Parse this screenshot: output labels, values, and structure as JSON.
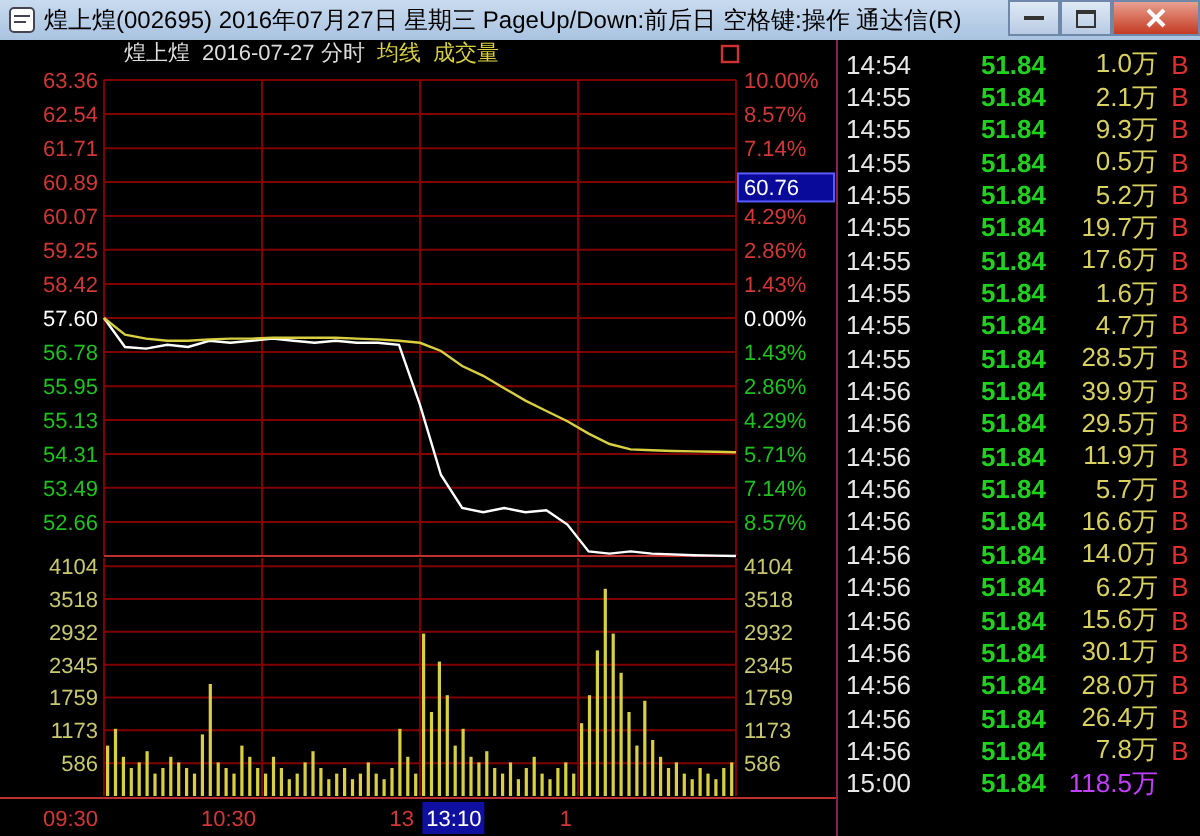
{
  "window": {
    "title": "煌上煌(002695) 2016年07月27日 星期三 PageUp/Down:前后日 空格键:操作 通达信(R)"
  },
  "header": {
    "stock": "煌上煌",
    "period": "2016-07-27 分时"
  },
  "price_chart": {
    "chart_data": {
      "type": "line",
      "grid": true,
      "series": [
        {
          "color": "#ffffff",
          "values": [
            57.6,
            56.9,
            56.86,
            56.95,
            56.9,
            57.05,
            57.0,
            57.05,
            57.1,
            57.05,
            57.0,
            57.05,
            57.0,
            57.0,
            56.95,
            55.5,
            53.8,
            53.0,
            52.9,
            53.0,
            52.9,
            52.95,
            52.6,
            51.95,
            51.9,
            51.95,
            51.9,
            51.88,
            51.86,
            51.85,
            51.84
          ]
        },
        {
          "name": "均线",
          "color": "#d8d040",
          "values": [
            57.6,
            57.2,
            57.1,
            57.05,
            57.05,
            57.08,
            57.1,
            57.1,
            57.12,
            57.12,
            57.12,
            57.12,
            57.1,
            57.08,
            57.05,
            57.0,
            56.8,
            56.44,
            56.2,
            55.9,
            55.6,
            55.35,
            55.1,
            54.8,
            54.55,
            54.42,
            54.4,
            54.38,
            54.37,
            54.36,
            54.35
          ]
        }
      ],
      "ylim": [
        51.84,
        63.36
      ],
      "yticks": [
        {
          "value": 63.36,
          "label": "63.36"
        },
        {
          "value": 62.54,
          "label": "62.54"
        },
        {
          "value": 61.71,
          "label": "61.71"
        },
        {
          "value": 60.89,
          "label": "60.89"
        },
        {
          "value": 60.07,
          "label": "60.07"
        },
        {
          "value": 59.25,
          "label": "59.25"
        },
        {
          "value": 58.42,
          "label": "58.42"
        },
        {
          "value": 57.6,
          "label": "57.60"
        },
        {
          "value": 56.78,
          "label": "56.78"
        },
        {
          "value": 55.95,
          "label": "55.95"
        },
        {
          "value": 55.13,
          "label": "55.13"
        },
        {
          "value": 54.31,
          "label": "54.31"
        },
        {
          "value": 53.49,
          "label": "53.49"
        },
        {
          "value": 52.66,
          "label": "52.66"
        }
      ]
    },
    "percent_labels": [
      {
        "text": "10.00%",
        "kind": "up"
      },
      {
        "text": "8.57%",
        "kind": "up"
      },
      {
        "text": "7.14%",
        "kind": "up"
      },
      {
        "text": "4.29%",
        "kind": "up"
      },
      {
        "text": "2.86%",
        "kind": "up"
      },
      {
        "text": "1.43%",
        "kind": "up"
      },
      {
        "text": "0.00%",
        "kind": "zero"
      },
      {
        "text": "1.43%",
        "kind": "down"
      },
      {
        "text": "2.86%",
        "kind": "down"
      },
      {
        "text": "4.29%",
        "kind": "down"
      },
      {
        "text": "5.71%",
        "kind": "down"
      },
      {
        "text": "7.14%",
        "kind": "down"
      },
      {
        "text": "8.57%",
        "kind": "down"
      }
    ],
    "cursor_price": "60.76"
  },
  "volume_chart": {
    "chart_data": {
      "type": "bar",
      "grid": true,
      "series": [
        {
          "name": "成交量",
          "color": "#d8d040",
          "values": [
            900,
            1200,
            700,
            500,
            600,
            800,
            400,
            500,
            700,
            600,
            500,
            400,
            1100,
            2000,
            600,
            500,
            400,
            900,
            700,
            500,
            400,
            700,
            500,
            300,
            400,
            600,
            800,
            500,
            300,
            400,
            500,
            300,
            400,
            600,
            400,
            300,
            500,
            1200,
            700,
            400,
            2900,
            1500,
            2400,
            1800,
            900,
            1200,
            700,
            600,
            800,
            500,
            400,
            600,
            300,
            500,
            700,
            400,
            300,
            500,
            600,
            400,
            1300,
            1800,
            2600,
            3700,
            2900,
            2200,
            1500,
            900,
            1700,
            1000,
            700,
            500,
            600,
            400,
            300,
            500,
            400,
            300,
            500,
            600
          ]
        }
      ],
      "ylim": [
        0,
        4250
      ],
      "yticks": [
        {
          "value": 4104,
          "label": "4104"
        },
        {
          "value": 3518,
          "label": "3518"
        },
        {
          "value": 2932,
          "label": "2932"
        },
        {
          "value": 2345,
          "label": "2345"
        },
        {
          "value": 1759,
          "label": "1759"
        },
        {
          "value": 1173,
          "label": "1173"
        },
        {
          "value": 586,
          "label": "586"
        }
      ]
    },
    "time_axis": [
      "09:30",
      "10:30",
      "13",
      "1"
    ],
    "right_labels": [
      "4104",
      "3518",
      "2932",
      "2345",
      "1759",
      "1173",
      "586"
    ],
    "cursor_time": "13:10"
  },
  "ticks": [
    {
      "time": "14:54",
      "price": "51.84",
      "volume": "1.0万",
      "side": "B",
      "large": false
    },
    {
      "time": "14:55",
      "price": "51.84",
      "volume": "2.1万",
      "side": "B",
      "large": false
    },
    {
      "time": "14:55",
      "price": "51.84",
      "volume": "9.3万",
      "side": "B",
      "large": false
    },
    {
      "time": "14:55",
      "price": "51.84",
      "volume": "0.5万",
      "side": "B",
      "large": false
    },
    {
      "time": "14:55",
      "price": "51.84",
      "volume": "5.2万",
      "side": "B",
      "large": false
    },
    {
      "time": "14:55",
      "price": "51.84",
      "volume": "19.7万",
      "side": "B",
      "large": false
    },
    {
      "time": "14:55",
      "price": "51.84",
      "volume": "17.6万",
      "side": "B",
      "large": false
    },
    {
      "time": "14:55",
      "price": "51.84",
      "volume": "1.6万",
      "side": "B",
      "large": false
    },
    {
      "time": "14:55",
      "price": "51.84",
      "volume": "4.7万",
      "side": "B",
      "large": false
    },
    {
      "time": "14:55",
      "price": "51.84",
      "volume": "28.5万",
      "side": "B",
      "large": false
    },
    {
      "time": "14:56",
      "price": "51.84",
      "volume": "39.9万",
      "side": "B",
      "large": false
    },
    {
      "time": "14:56",
      "price": "51.84",
      "volume": "29.5万",
      "side": "B",
      "large": false
    },
    {
      "time": "14:56",
      "price": "51.84",
      "volume": "11.9万",
      "side": "B",
      "large": false
    },
    {
      "time": "14:56",
      "price": "51.84",
      "volume": "5.7万",
      "side": "B",
      "large": false
    },
    {
      "time": "14:56",
      "price": "51.84",
      "volume": "16.6万",
      "side": "B",
      "large": false
    },
    {
      "time": "14:56",
      "price": "51.84",
      "volume": "14.0万",
      "side": "B",
      "large": false
    },
    {
      "time": "14:56",
      "price": "51.84",
      "volume": "6.2万",
      "side": "B",
      "large": false
    },
    {
      "time": "14:56",
      "price": "51.84",
      "volume": "15.6万",
      "side": "B",
      "large": false
    },
    {
      "time": "14:56",
      "price": "51.84",
      "volume": "30.1万",
      "side": "B",
      "large": false
    },
    {
      "time": "14:56",
      "price": "51.84",
      "volume": "28.0万",
      "side": "B",
      "large": false
    },
    {
      "time": "14:56",
      "price": "51.84",
      "volume": "26.4万",
      "side": "B",
      "large": false
    },
    {
      "time": "14:56",
      "price": "51.84",
      "volume": "7.8万",
      "side": "B",
      "large": false
    },
    {
      "time": "15:00",
      "price": "51.84",
      "volume": "118.5万",
      "large": true
    }
  ]
}
